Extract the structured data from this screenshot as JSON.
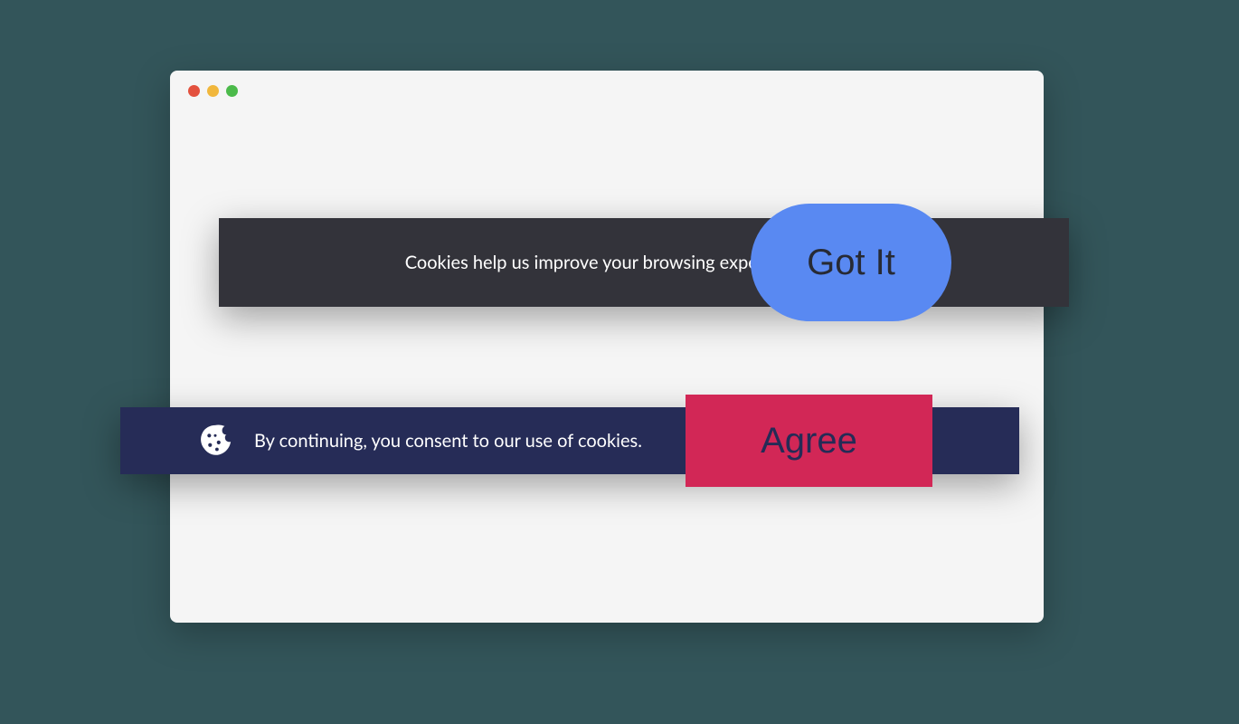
{
  "banner1": {
    "message": "Cookies help us improve your browsing experience.",
    "button_label": "Got It"
  },
  "banner2": {
    "icon": "cookie-icon",
    "message": "By continuing, you consent to our use of cookies.",
    "button_label": "Agree"
  },
  "colors": {
    "background": "#33555a",
    "window_bg": "#f5f5f5",
    "banner1_bg": "#33333a",
    "banner1_button": "#5989f2",
    "banner2_bg": "#262c57",
    "banner2_button": "#d22756"
  }
}
